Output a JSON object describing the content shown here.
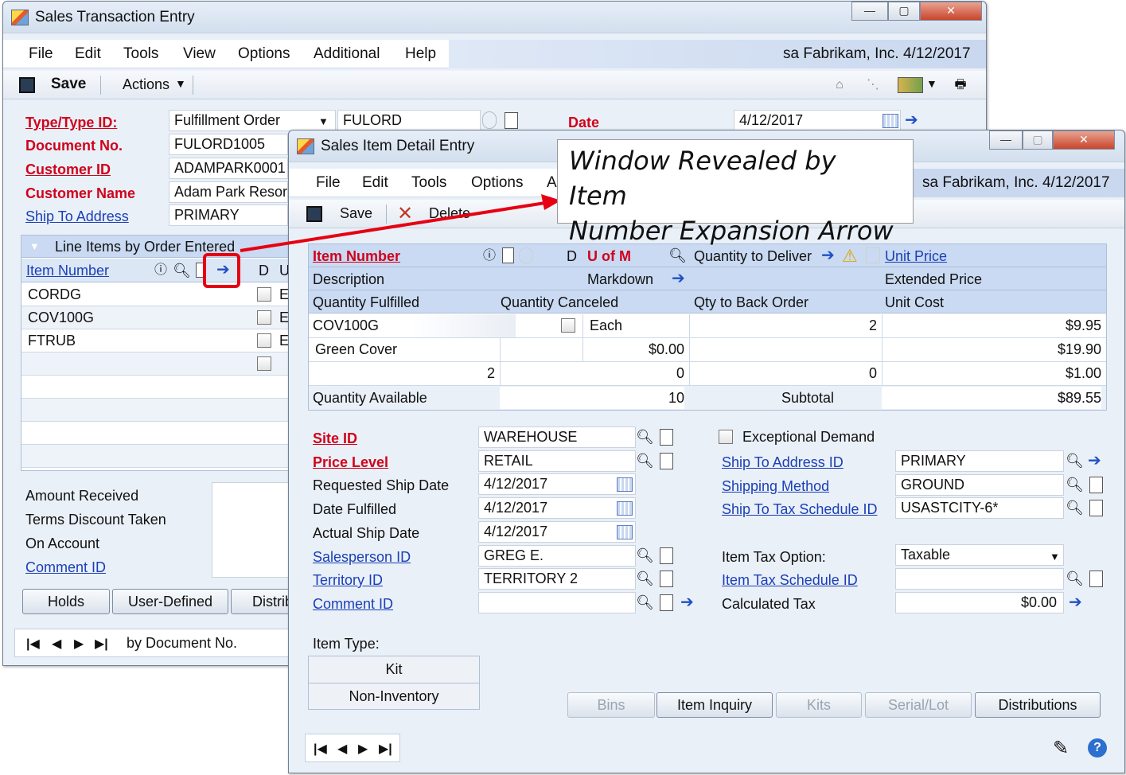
{
  "sales_transaction": {
    "title": "Sales Transaction Entry",
    "menu": [
      "File",
      "Edit",
      "Tools",
      "View",
      "Options",
      "Additional",
      "Help"
    ],
    "user_info": "sa  Fabrikam, Inc. 4/12/2017",
    "toolbar": {
      "save": "Save",
      "actions": "Actions"
    },
    "labels": {
      "type_id": "Type/Type ID:",
      "document_no": "Document No.",
      "customer_id": "Customer ID",
      "customer_name": "Customer Name",
      "ship_to": "Ship To Address",
      "date": "Date"
    },
    "values": {
      "type_select": "Fulfillment Order",
      "type_id": "FULORD",
      "document_no": "FULORD1005",
      "customer_id": "ADAMPARK0001",
      "customer_name": "Adam Park Resort",
      "ship_to": "PRIMARY",
      "date": "4/12/2017"
    },
    "line_items": {
      "title": "Line Items by Order Entered",
      "col_item": "Item Number",
      "col_d": "D",
      "col_u": "U",
      "rows": [
        {
          "item": "CORDG",
          "u": "E"
        },
        {
          "item": "COV100G",
          "u": "E"
        },
        {
          "item": "FTRUB",
          "u": "E"
        }
      ]
    },
    "bottom_labels": [
      "Amount Received",
      "Terms Discount Taken",
      "On Account",
      "Comment ID"
    ],
    "buttons": {
      "holds": "Holds",
      "user_defined": "User-Defined",
      "distrib": "Distrib"
    },
    "sort": "by Document No."
  },
  "callout": {
    "line1": "Window Revealed by Item",
    "line2": "Number Expansion Arrow"
  },
  "item_detail": {
    "title": "Sales Item Detail Entry",
    "menu": [
      "File",
      "Edit",
      "Tools",
      "Options",
      "A"
    ],
    "user_info": "sa  Fabrikam, Inc. 4/12/2017",
    "toolbar": {
      "save": "Save",
      "delete": "Delete"
    },
    "grid_headers": {
      "item_number": "Item Number",
      "d": "D",
      "u_of_m": "U of M",
      "qty_deliver": "Quantity to Deliver",
      "unit_price": "Unit Price",
      "description": "Description",
      "markdown": "Markdown",
      "extended_price": "Extended Price",
      "qty_fulfilled": "Quantity Fulfilled",
      "qty_canceled": "Quantity Canceled",
      "qty_back": "Qty to Back Order",
      "unit_cost": "Unit Cost"
    },
    "grid": {
      "item": "COV100G",
      "uom": "Each",
      "qty_deliver": "2",
      "unit_price": "$9.95",
      "description": "Green Cover",
      "markdown": "$0.00",
      "extended_price": "$19.90",
      "qty_fulfilled": "2",
      "qty_canceled": "0",
      "qty_back": "0",
      "unit_cost": "$1.00",
      "qty_available_label": "Quantity Available",
      "qty_available": "10",
      "subtotal_label": "Subtotal",
      "subtotal": "$89.55"
    },
    "left_labels": {
      "site": "Site ID",
      "price_level": "Price Level",
      "req_ship": "Requested Ship Date",
      "date_fulfilled": "Date Fulfilled",
      "actual_ship": "Actual Ship Date",
      "salesperson": "Salesperson ID",
      "territory": "Territory ID",
      "comment": "Comment ID"
    },
    "left_values": {
      "site": "WAREHOUSE",
      "price_level": "RETAIL",
      "req_ship": "4/12/2017",
      "date_fulfilled": "4/12/2017",
      "actual_ship": "4/12/2017",
      "salesperson": "GREG E.",
      "territory": "TERRITORY 2",
      "comment": ""
    },
    "right_labels": {
      "exceptional": "Exceptional Demand",
      "ship_to": "Ship To Address ID",
      "shipping": "Shipping Method",
      "ship_tax": "Ship To Tax Schedule ID",
      "item_tax_option": "Item Tax Option:",
      "item_tax_sched": "Item Tax Schedule ID",
      "calc_tax": "Calculated Tax"
    },
    "right_values": {
      "ship_to": "PRIMARY",
      "shipping": "GROUND",
      "ship_tax": "USASTCITY-6*",
      "item_tax_option": "Taxable",
      "item_tax_sched": "",
      "calc_tax": "$0.00"
    },
    "item_type": {
      "label": "Item Type:",
      "options": [
        "Kit",
        "Non-Inventory"
      ]
    },
    "buttons": {
      "bins": "Bins",
      "item_inquiry": "Item Inquiry",
      "kits": "Kits",
      "serial_lot": "Serial/Lot",
      "distributions": "Distributions"
    }
  }
}
